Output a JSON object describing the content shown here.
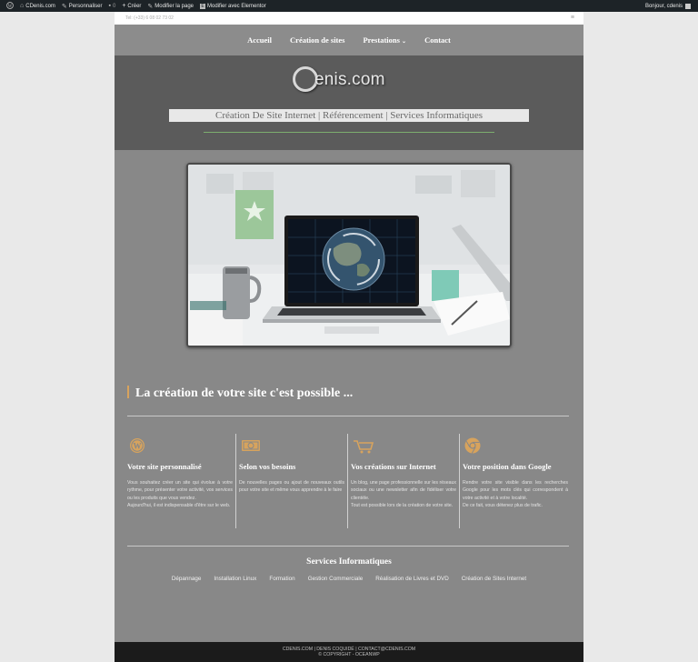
{
  "adminbar": {
    "site_name": "CDenis.com",
    "customize": "Personnaliser",
    "comments_count": "0",
    "new_label": "Créer",
    "edit_page": "Modifier la page",
    "edit_elementor": "Modifier avec Elementor",
    "greeting": "Bonjour, cdenis"
  },
  "topbar": {
    "phone": "Tel: (+33) 6 08 02 73 02"
  },
  "nav": {
    "items": [
      "Accueil",
      "Création de sites",
      "Prestations",
      "Contact"
    ]
  },
  "hero": {
    "logo_text": "enis.com",
    "tagline": "Création De Site Internet | Référencement | Services Informatiques",
    "accent_color": "#7cae6e"
  },
  "main": {
    "heading": "La création de votre site c'est possible ...",
    "features": [
      {
        "icon": "wordpress-icon",
        "title": "Votre site personnalisé",
        "lines": [
          "Vous souhaitez créer un site qui évolue à votre rythme, pour présenter votre activité, vos services ou les produits que vous vendez.",
          "Aujourd'hui, il est indispensable d'être sur le web."
        ]
      },
      {
        "icon": "money-icon",
        "title": "Selon vos besoins",
        "lines": [
          "De nouvelles pages ou ajout de nouveaux outils pour votre site et même vous apprendre à le faire"
        ]
      },
      {
        "icon": "cart-icon",
        "title": "Vos créations sur Internet",
        "lines": [
          "Un blog, une page professionnelle sur les réseaux sociaux ou une newsletter afin de fidéliser votre clientèle.",
          "Tout est possible lors de la création de votre site."
        ]
      },
      {
        "icon": "chrome-icon",
        "title": "Votre position dans Google",
        "lines": [
          "Rendre votre site visible dans les recherches Google pour les mots clés qui correspondent à votre activité et à votre localité.",
          "De ce fait, vous détenez plus de trafic."
        ]
      }
    ],
    "accent_color": "#d7a35d"
  },
  "services": {
    "title": "Services Informatiques",
    "links": [
      "Dépannage",
      "Installation Linux",
      "Formation",
      "Gestion Commerciale",
      "Réalisation de Livres et DVD",
      "Création de Sites Internet"
    ]
  },
  "footer": {
    "line1": "CDENIS.COM | DENIS COQUIDÉ | CONTACT@CDENIS.COM",
    "line2": "© COPYRIGHT - OCEANWP"
  }
}
